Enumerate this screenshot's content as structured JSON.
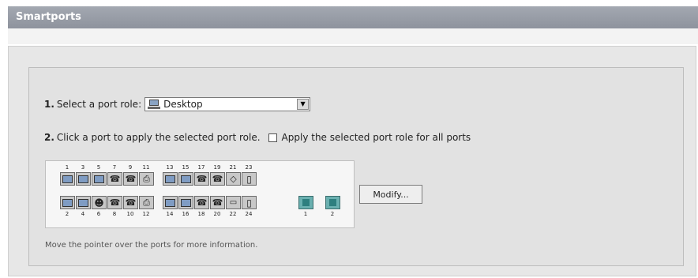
{
  "header": {
    "title": "Smartports"
  },
  "step1": {
    "number": "1.",
    "label": "Select a port role:",
    "selected_role": "Desktop",
    "selected_role_icon": "desktop-icon"
  },
  "step2": {
    "number": "2.",
    "label": "Click a port to apply the selected port role.",
    "apply_all_label": "Apply the selected port role for all ports",
    "apply_all_checked": false
  },
  "ports": {
    "top_numbers": [
      "1",
      "3",
      "5",
      "7",
      "9",
      "11",
      "13",
      "15",
      "17",
      "19",
      "21",
      "23"
    ],
    "bottom_numbers": [
      "2",
      "4",
      "6",
      "8",
      "10",
      "12",
      "14",
      "16",
      "18",
      "20",
      "22",
      "24"
    ],
    "top_roles": [
      "desktop",
      "desktop",
      "desktop",
      "phone",
      "phone",
      "printer",
      "desktop",
      "desktop",
      "phone",
      "phone",
      "router",
      "server"
    ],
    "bottom_roles": [
      "desktop",
      "desktop",
      "person",
      "phone",
      "phone",
      "printer",
      "desktop",
      "desktop",
      "phone",
      "phone",
      "other",
      "server"
    ],
    "uplink_numbers": [
      "1",
      "2"
    ]
  },
  "modify_button": {
    "label": "Modify..."
  },
  "hint": "Move the pointer over the ports for more information."
}
